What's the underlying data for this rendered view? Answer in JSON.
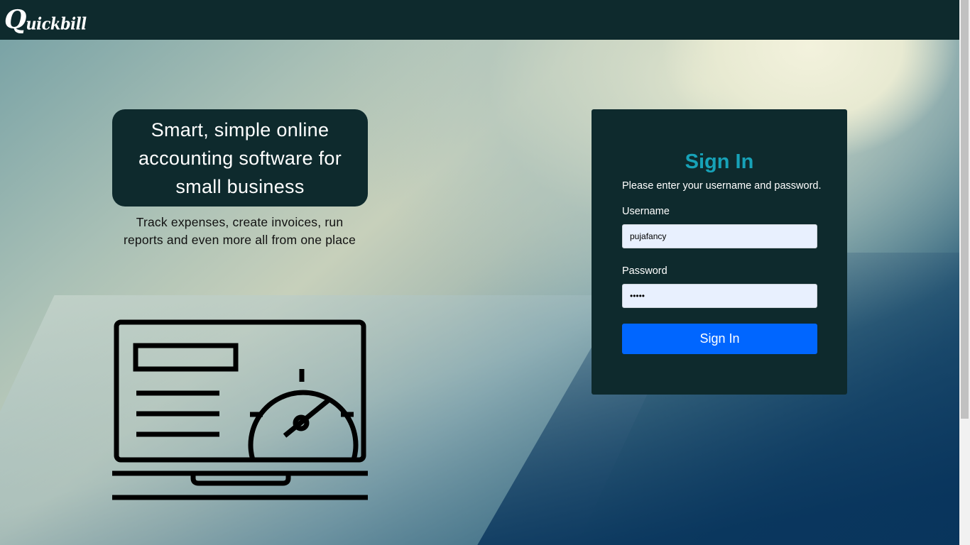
{
  "header": {
    "logo_letter": "Q",
    "logo_rest": "uickbill"
  },
  "hero": {
    "tagline": "Smart, simple online accounting software for small business",
    "subtagline": "Track expenses, create invoices, run reports and even more all from one place",
    "illustration_icon": "laptop-dashboard-icon"
  },
  "login": {
    "title": "Sign In",
    "instructions": "Please enter your username and password.",
    "username_label": "Username",
    "username_value": "pujafancy",
    "password_label": "Password",
    "password_value": "•••••",
    "submit_label": "Sign In"
  },
  "colors": {
    "header_bg": "#0e2a2d",
    "card_bg": "#0e2a2d",
    "title_accent": "#17a2b8",
    "button_bg": "#0066ff",
    "input_bg": "#e8f0fe"
  }
}
